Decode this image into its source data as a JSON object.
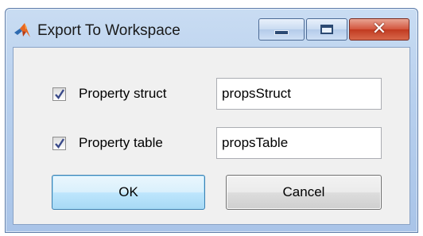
{
  "window": {
    "title": "Export To Workspace",
    "icon": "matlab-logo-icon"
  },
  "form": {
    "rows": [
      {
        "label": "Property struct",
        "checked": true,
        "value": "propsStruct"
      },
      {
        "label": "Property table",
        "checked": true,
        "value": "propsTable"
      }
    ]
  },
  "buttons": {
    "ok_label": "OK",
    "cancel_label": "Cancel"
  },
  "colors": {
    "title_gradient_top": "#c9dcf2",
    "close_button": "#c13a20",
    "ok_border": "#3c7fb1",
    "check": "#3a4a8a"
  }
}
